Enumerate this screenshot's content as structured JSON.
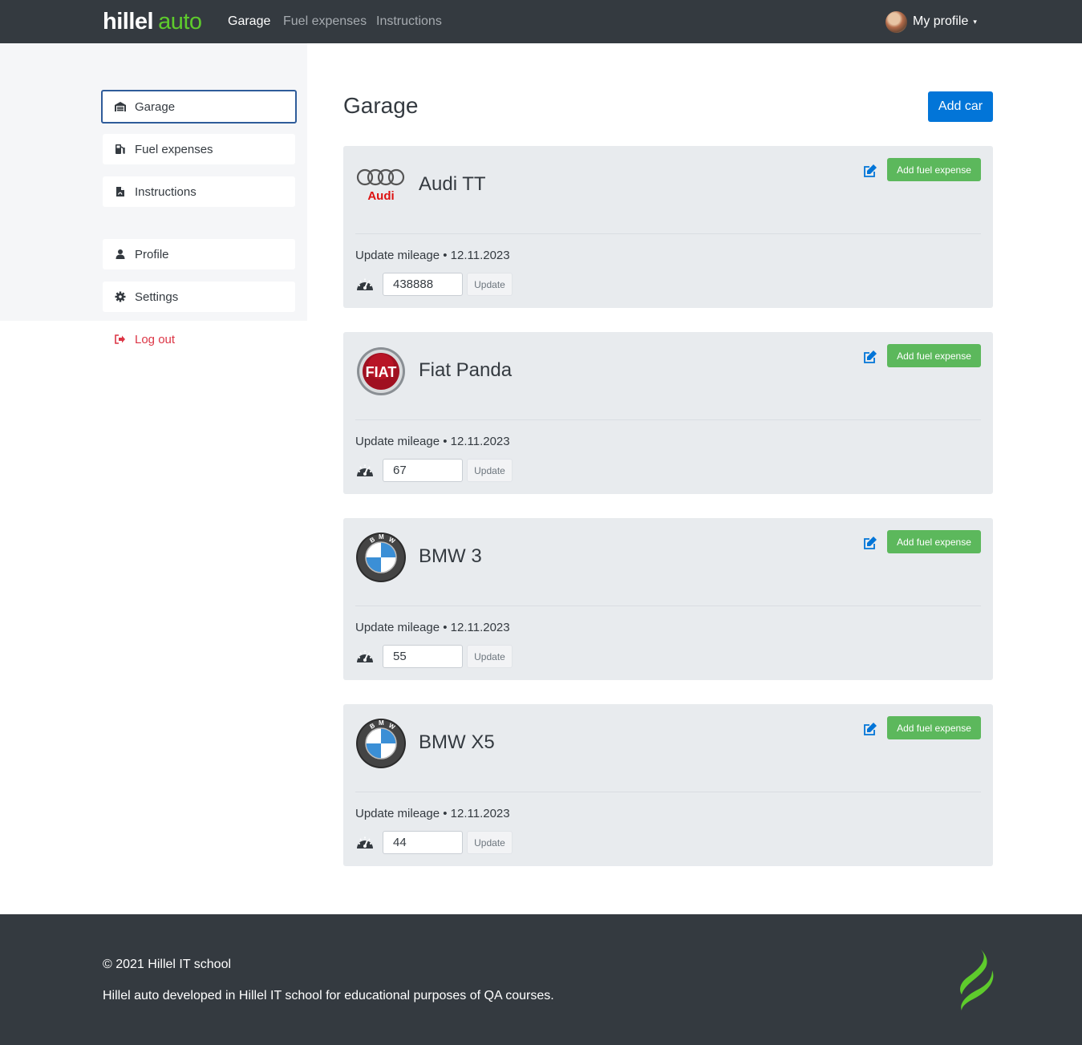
{
  "header": {
    "logo_part1": "hillel",
    "logo_part2": "auto",
    "nav": [
      "Garage",
      "Fuel expenses",
      "Instructions"
    ],
    "profile_label": "My profile",
    "caret": "▾"
  },
  "sidebar": {
    "items": [
      {
        "label": "Garage",
        "icon": "garage-icon"
      },
      {
        "label": "Fuel expenses",
        "icon": "fuel-icon"
      },
      {
        "label": "Instructions",
        "icon": "file-icon"
      },
      {
        "label": "Profile",
        "icon": "user-icon"
      },
      {
        "label": "Settings",
        "icon": "gear-icon"
      }
    ],
    "logout_label": "Log out"
  },
  "main": {
    "title": "Garage",
    "add_car_label": "Add car",
    "cars": [
      {
        "name": "Audi TT",
        "brand": "audi",
        "mileage_label": "Update mileage • 12.11.2023",
        "mileage": "438888",
        "fuel_label": "Add fuel expense",
        "update_label": "Update"
      },
      {
        "name": "Fiat Panda",
        "brand": "fiat",
        "mileage_label": "Update mileage • 12.11.2023",
        "mileage": "67",
        "fuel_label": "Add fuel expense",
        "update_label": "Update"
      },
      {
        "name": "BMW 3",
        "brand": "bmw",
        "mileage_label": "Update mileage • 12.11.2023",
        "mileage": "55",
        "fuel_label": "Add fuel expense",
        "update_label": "Update"
      },
      {
        "name": "BMW X5",
        "brand": "bmw",
        "mileage_label": "Update mileage • 12.11.2023",
        "mileage": "44",
        "fuel_label": "Add fuel expense",
        "update_label": "Update"
      }
    ]
  },
  "footer": {
    "copyright": "© 2021 Hillel IT school",
    "description": "Hillel auto developed in Hillel IT school for educational purposes of QA courses."
  },
  "colors": {
    "brand_green": "#5ecb2c",
    "primary": "#0275d8",
    "success": "#5cb85c",
    "danger": "#dc3545",
    "dark": "#343a40"
  }
}
